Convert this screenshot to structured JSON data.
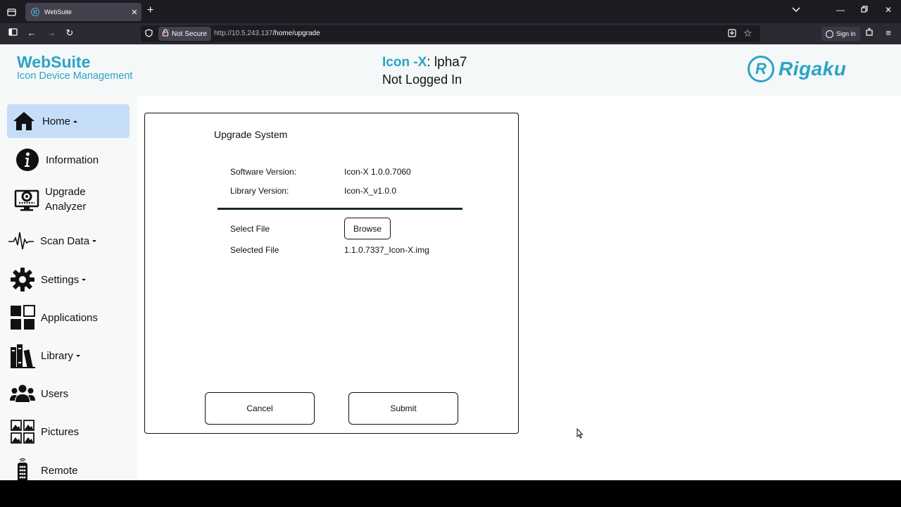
{
  "browser": {
    "tab_title": "WebSuite",
    "not_secure_label": "Not Secure",
    "url_host": "http://10.5.243.137",
    "url_path": "/home/upgrade",
    "sign_in_label": "Sign in"
  },
  "header": {
    "brand_title": "WebSuite",
    "brand_subtitle": "Icon Device Management",
    "device_name": "Icon -X",
    "device_suffix": ": lpha7",
    "login_status": "Not Logged In",
    "logo_text": "Rigaku"
  },
  "sidebar": {
    "items": [
      {
        "label": "Home",
        "icon": "home-icon"
      },
      {
        "label": "Information",
        "icon": "info-icon"
      },
      {
        "label": "Upgrade",
        "label2": "Analyzer",
        "icon": "upgrade-analyzer-icon"
      },
      {
        "label": "Scan Data",
        "icon": "waveform-icon"
      },
      {
        "label": "Settings",
        "icon": "gear-icon"
      },
      {
        "label": "Applications",
        "icon": "grid-icon"
      },
      {
        "label": "Library",
        "icon": "books-icon"
      },
      {
        "label": "Users",
        "icon": "users-icon"
      },
      {
        "label": "Pictures",
        "icon": "pictures-icon"
      },
      {
        "label": "Remote",
        "icon": "remote-icon"
      }
    ]
  },
  "dialog": {
    "title": "Upgrade System",
    "software_version_label": "Software Version:",
    "software_version_value": "Icon-X 1.0.0.7060",
    "library_version_label": "Library Version:",
    "library_version_value": "Icon-X_v1.0.0",
    "select_file_label": "Select File",
    "browse_label": "Browse",
    "selected_file_label": "Selected File",
    "selected_file_value": "1.1.0.7337_Icon-X.img",
    "cancel_label": "Cancel",
    "submit_label": "Submit"
  },
  "colors": {
    "accent": "#2aa4c5",
    "active_nav": "#c6ddfa"
  }
}
